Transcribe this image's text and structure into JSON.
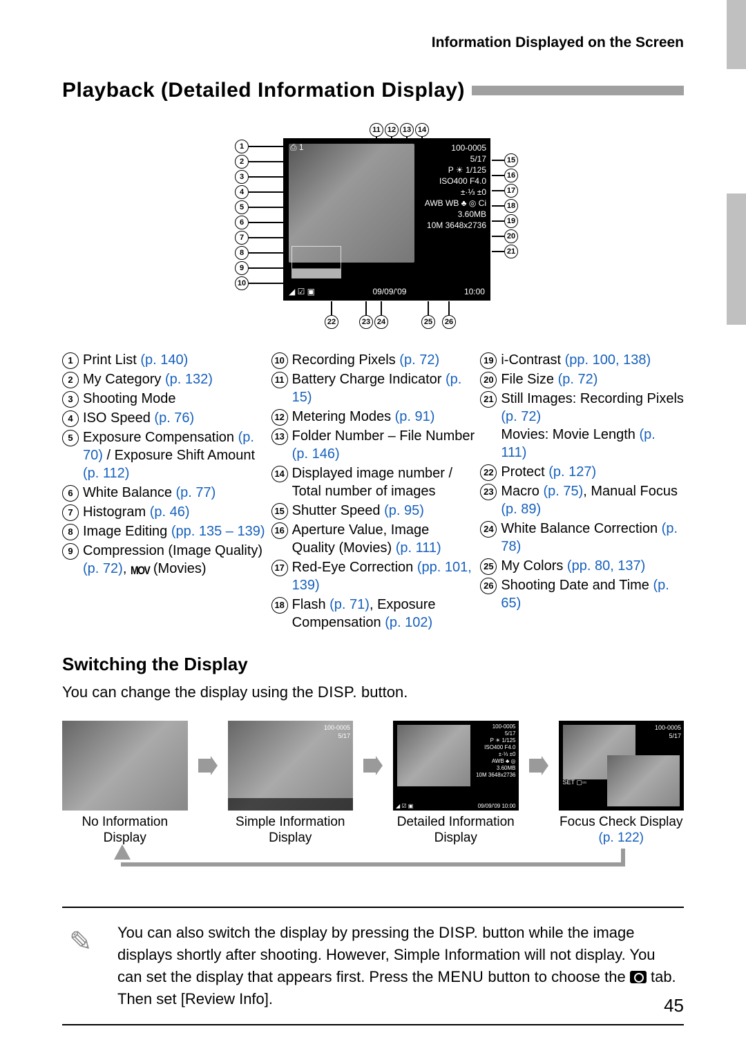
{
  "breadcrumb": "Information Displayed on the Screen",
  "title": "Playback (Detailed Information Display)",
  "diagram_overlay": {
    "top_icons": "⎙ 1",
    "right_lines": [
      "100-0005",
      "5/17",
      "P ☀ 1/125",
      "ISO400  F4.0",
      "±·⅓ ±0",
      "AWB WB ♣ ◎ Ci",
      "3.60MB",
      "10M 3648x2736"
    ],
    "bottom_left": "◢ ☑ ▣",
    "bottom_date": "09/09/'09",
    "bottom_time": "10:00"
  },
  "callouts_left": [
    "1",
    "2",
    "3",
    "4",
    "5",
    "6",
    "7",
    "8",
    "9",
    "10"
  ],
  "callouts_top": [
    "11",
    "12",
    "13",
    "14"
  ],
  "callouts_right": [
    "15",
    "16",
    "17",
    "18",
    "19",
    "20",
    "21"
  ],
  "callouts_bottom": [
    "22",
    "23",
    "24",
    "25",
    "26"
  ],
  "col1": [
    {
      "n": "1",
      "t": "Print List ",
      "l": "(p. 140)"
    },
    {
      "n": "2",
      "t": "My Category ",
      "l": "(p. 132)"
    },
    {
      "n": "3",
      "t": "Shooting Mode",
      "l": ""
    },
    {
      "n": "4",
      "t": "ISO Speed ",
      "l": "(p. 76)"
    },
    {
      "n": "5",
      "t": "Exposure Compensation ",
      "l": "(p. 70)",
      "t2": " / Exposure Shift Amount ",
      "l2": "(p. 112)"
    },
    {
      "n": "6",
      "t": "White Balance ",
      "l": "(p. 77)"
    },
    {
      "n": "7",
      "t": "Histogram ",
      "l": "(p. 46)"
    },
    {
      "n": "8",
      "t": "Image Editing ",
      "l": "(pp. 135 – 139)"
    },
    {
      "n": "9",
      "t": "Compression (Image Quality) ",
      "l": "(p. 72)",
      "t2": ", ",
      "mov": true,
      "t3": " (Movies)"
    }
  ],
  "col2": [
    {
      "n": "10",
      "t": "Recording Pixels ",
      "l": "(p. 72)"
    },
    {
      "n": "11",
      "t": "Battery Charge Indicator ",
      "l": "(p. 15)"
    },
    {
      "n": "12",
      "t": "Metering Modes ",
      "l": "(p. 91)"
    },
    {
      "n": "13",
      "t": "Folder Number – File Number ",
      "l": "(p. 146)"
    },
    {
      "n": "14",
      "t": "Displayed image number / Total number of images",
      "l": ""
    },
    {
      "n": "15",
      "t": "Shutter Speed ",
      "l": "(p. 95)"
    },
    {
      "n": "16",
      "t": "Aperture Value, Image Quality (Movies) ",
      "l": "(p. 111)"
    },
    {
      "n": "17",
      "t": "Red-Eye Correction ",
      "l": "(pp. 101, 139)"
    },
    {
      "n": "18",
      "t": "Flash ",
      "l": "(p. 71)",
      "t2": ", Exposure Compensation ",
      "l2": "(p. 102)"
    }
  ],
  "col3": [
    {
      "n": "19",
      "t": "i-Contrast ",
      "l": "(pp. 100, 138)"
    },
    {
      "n": "20",
      "t": "File Size ",
      "l": "(p. 72)"
    },
    {
      "n": "21",
      "t": "Still Images: Recording Pixels ",
      "l": "(p. 72)",
      "t2": "\nMovies: Movie Length ",
      "l2": "(p. 111)"
    },
    {
      "n": "22",
      "t": "Protect ",
      "l": "(p. 127)"
    },
    {
      "n": "23",
      "t": "Macro ",
      "l": "(p. 75)",
      "t2": ", Manual Focus ",
      "l2": "(p. 89)"
    },
    {
      "n": "24",
      "t": "White Balance Correction ",
      "l": "(p. 78)"
    },
    {
      "n": "25",
      "t": "My Colors ",
      "l": "(pp. 80, 137)"
    },
    {
      "n": "26",
      "t": "Shooting Date and Time ",
      "l": "(p. 65)"
    }
  ],
  "h2": "Switching the Display",
  "switch_text_a": "You can change the display using the ",
  "disp_label": "DISP.",
  "switch_text_b": " button.",
  "thumbs": [
    {
      "caption": "No Information Display",
      "link": ""
    },
    {
      "caption": "Simple Information Display",
      "link": ""
    },
    {
      "caption": "Detailed Information Display",
      "link": ""
    },
    {
      "caption": "Focus Check Display",
      "link": "(p. 122)"
    }
  ],
  "thumb_overlays": {
    "simple": [
      "100-0005",
      "5/17"
    ],
    "detailed": [
      "100-0005",
      "5/17",
      "P ☀ 1/125",
      "ISO400  F4.0",
      "±·⅓ ±0",
      "AWB ♣ ◎",
      "3.60MB",
      "10M 3648x2736",
      "09/09/'09 10:00"
    ],
    "focus": [
      "100-0005",
      "5/17",
      "SET ▢▫▫"
    ]
  },
  "note_a": "You can also switch the display by pressing the ",
  "note_b": " button while the image displays shortly after shooting. However, Simple Information will not display. You can set the display that appears first. Press the ",
  "menu_label": "MENU",
  "note_c": " button to choose the ",
  "note_d": " tab. Then set [Review Info].",
  "page_number": "45"
}
